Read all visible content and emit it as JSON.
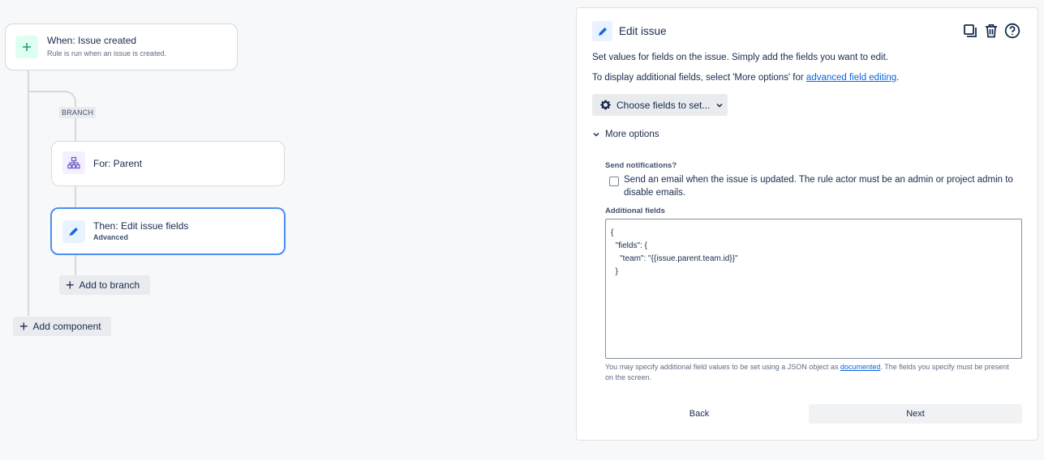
{
  "canvas": {
    "trigger": {
      "title": "When: Issue created",
      "subtitle": "Rule is run when an issue is created."
    },
    "branch_tag": "BRANCH",
    "branch_node": {
      "title": "For: Parent"
    },
    "action_node": {
      "title": "Then: Edit issue fields",
      "subtitle": "Advanced"
    },
    "add_to_branch_label": "Add to branch",
    "add_component_label": "Add component"
  },
  "panel": {
    "title": "Edit issue",
    "description": "Set values for fields on the issue. Simply add the fields you want to edit.",
    "additional_hint_prefix": "To display additional fields, select 'More options' for ",
    "additional_hint_link": "advanced field editing",
    "additional_hint_suffix": ".",
    "choose_fields_label": "Choose fields to set...",
    "more_options_label": "More options",
    "send_notifications_label": "Send notifications?",
    "send_email_text": "Send an email when the issue is updated. The rule actor must be an admin or project admin to disable emails.",
    "send_email_checked": false,
    "additional_fields_label": "Additional fields",
    "additional_fields_value": "{\n  \"fields\": {\n    \"team\": \"{{issue.parent.team.id}}\"\n  }",
    "help_prefix": "You may specify additional field values to be set using a JSON object as ",
    "help_link": "documented",
    "help_suffix": ". The fields you specify must be present on the screen.",
    "back_label": "Back",
    "next_label": "Next",
    "icons": {
      "duplicate": "duplicate-icon",
      "delete": "trash-icon",
      "help": "help-icon"
    }
  },
  "colors": {
    "accent": "#4c8df6",
    "trigger_icon_bg": "#dcfff1",
    "branch_icon_bg": "#f3f0ff",
    "action_icon_bg": "#e9f2ff"
  }
}
